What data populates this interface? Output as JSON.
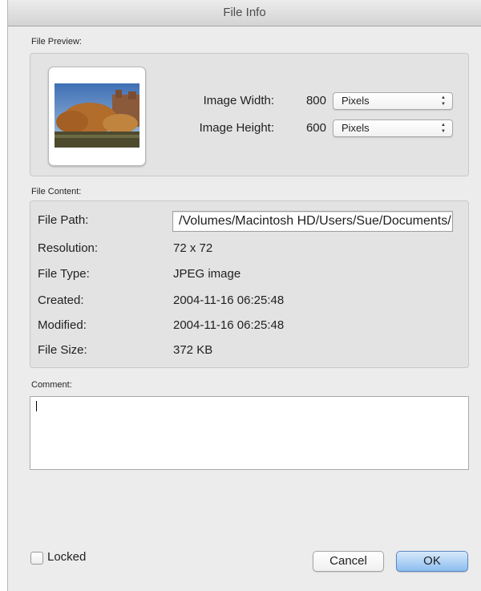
{
  "window": {
    "title": "File Info"
  },
  "preview": {
    "section_label": "File Preview:",
    "image_width_label": "Image Width:",
    "image_width_value": "800",
    "image_width_unit": "Pixels",
    "image_height_label": "Image Height:",
    "image_height_value": "600",
    "image_height_unit": "Pixels"
  },
  "content": {
    "section_label": "File Content:",
    "file_path_label": "File Path:",
    "file_path_value": "/Volumes/Macintosh HD/Users/Sue/Documents/Photos/campus.jpg",
    "rows": [
      {
        "label": "Resolution:",
        "value": "72 x 72"
      },
      {
        "label": "File Type:",
        "value": "JPEG image"
      },
      {
        "label": "Created:",
        "value": "2004-11-16 06:25:48"
      },
      {
        "label": "Modified:",
        "value": "2004-11-16 06:25:48"
      },
      {
        "label": "File Size:",
        "value": "372 KB"
      }
    ]
  },
  "comment": {
    "section_label": "Comment:",
    "value": ""
  },
  "footer": {
    "locked_label": "Locked",
    "locked_checked": false,
    "cancel_label": "Cancel",
    "ok_label": "OK"
  },
  "colors": {
    "window_bg": "#ececec",
    "group_bg": "#e3e3e3",
    "default_button": "#8cbdf0"
  },
  "icons": {
    "popup_arrows": "up-down-chevrons-icon"
  }
}
